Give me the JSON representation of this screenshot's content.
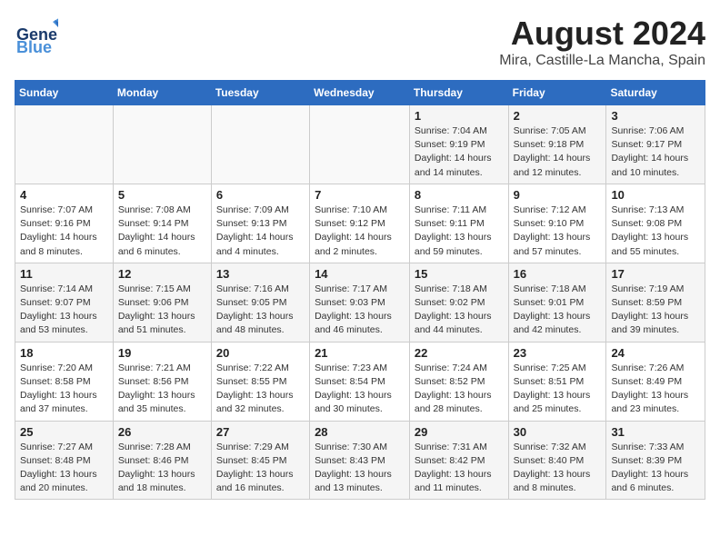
{
  "header": {
    "logo_general": "General",
    "logo_blue": "Blue",
    "month_year": "August 2024",
    "location": "Mira, Castille-La Mancha, Spain"
  },
  "days_of_week": [
    "Sunday",
    "Monday",
    "Tuesday",
    "Wednesday",
    "Thursday",
    "Friday",
    "Saturday"
  ],
  "weeks": [
    [
      {
        "day": "",
        "info": ""
      },
      {
        "day": "",
        "info": ""
      },
      {
        "day": "",
        "info": ""
      },
      {
        "day": "",
        "info": ""
      },
      {
        "day": "1",
        "info": "Sunrise: 7:04 AM\nSunset: 9:19 PM\nDaylight: 14 hours\nand 14 minutes."
      },
      {
        "day": "2",
        "info": "Sunrise: 7:05 AM\nSunset: 9:18 PM\nDaylight: 14 hours\nand 12 minutes."
      },
      {
        "day": "3",
        "info": "Sunrise: 7:06 AM\nSunset: 9:17 PM\nDaylight: 14 hours\nand 10 minutes."
      }
    ],
    [
      {
        "day": "4",
        "info": "Sunrise: 7:07 AM\nSunset: 9:16 PM\nDaylight: 14 hours\nand 8 minutes."
      },
      {
        "day": "5",
        "info": "Sunrise: 7:08 AM\nSunset: 9:14 PM\nDaylight: 14 hours\nand 6 minutes."
      },
      {
        "day": "6",
        "info": "Sunrise: 7:09 AM\nSunset: 9:13 PM\nDaylight: 14 hours\nand 4 minutes."
      },
      {
        "day": "7",
        "info": "Sunrise: 7:10 AM\nSunset: 9:12 PM\nDaylight: 14 hours\nand 2 minutes."
      },
      {
        "day": "8",
        "info": "Sunrise: 7:11 AM\nSunset: 9:11 PM\nDaylight: 13 hours\nand 59 minutes."
      },
      {
        "day": "9",
        "info": "Sunrise: 7:12 AM\nSunset: 9:10 PM\nDaylight: 13 hours\nand 57 minutes."
      },
      {
        "day": "10",
        "info": "Sunrise: 7:13 AM\nSunset: 9:08 PM\nDaylight: 13 hours\nand 55 minutes."
      }
    ],
    [
      {
        "day": "11",
        "info": "Sunrise: 7:14 AM\nSunset: 9:07 PM\nDaylight: 13 hours\nand 53 minutes."
      },
      {
        "day": "12",
        "info": "Sunrise: 7:15 AM\nSunset: 9:06 PM\nDaylight: 13 hours\nand 51 minutes."
      },
      {
        "day": "13",
        "info": "Sunrise: 7:16 AM\nSunset: 9:05 PM\nDaylight: 13 hours\nand 48 minutes."
      },
      {
        "day": "14",
        "info": "Sunrise: 7:17 AM\nSunset: 9:03 PM\nDaylight: 13 hours\nand 46 minutes."
      },
      {
        "day": "15",
        "info": "Sunrise: 7:18 AM\nSunset: 9:02 PM\nDaylight: 13 hours\nand 44 minutes."
      },
      {
        "day": "16",
        "info": "Sunrise: 7:18 AM\nSunset: 9:01 PM\nDaylight: 13 hours\nand 42 minutes."
      },
      {
        "day": "17",
        "info": "Sunrise: 7:19 AM\nSunset: 8:59 PM\nDaylight: 13 hours\nand 39 minutes."
      }
    ],
    [
      {
        "day": "18",
        "info": "Sunrise: 7:20 AM\nSunset: 8:58 PM\nDaylight: 13 hours\nand 37 minutes."
      },
      {
        "day": "19",
        "info": "Sunrise: 7:21 AM\nSunset: 8:56 PM\nDaylight: 13 hours\nand 35 minutes."
      },
      {
        "day": "20",
        "info": "Sunrise: 7:22 AM\nSunset: 8:55 PM\nDaylight: 13 hours\nand 32 minutes."
      },
      {
        "day": "21",
        "info": "Sunrise: 7:23 AM\nSunset: 8:54 PM\nDaylight: 13 hours\nand 30 minutes."
      },
      {
        "day": "22",
        "info": "Sunrise: 7:24 AM\nSunset: 8:52 PM\nDaylight: 13 hours\nand 28 minutes."
      },
      {
        "day": "23",
        "info": "Sunrise: 7:25 AM\nSunset: 8:51 PM\nDaylight: 13 hours\nand 25 minutes."
      },
      {
        "day": "24",
        "info": "Sunrise: 7:26 AM\nSunset: 8:49 PM\nDaylight: 13 hours\nand 23 minutes."
      }
    ],
    [
      {
        "day": "25",
        "info": "Sunrise: 7:27 AM\nSunset: 8:48 PM\nDaylight: 13 hours\nand 20 minutes."
      },
      {
        "day": "26",
        "info": "Sunrise: 7:28 AM\nSunset: 8:46 PM\nDaylight: 13 hours\nand 18 minutes."
      },
      {
        "day": "27",
        "info": "Sunrise: 7:29 AM\nSunset: 8:45 PM\nDaylight: 13 hours\nand 16 minutes."
      },
      {
        "day": "28",
        "info": "Sunrise: 7:30 AM\nSunset: 8:43 PM\nDaylight: 13 hours\nand 13 minutes."
      },
      {
        "day": "29",
        "info": "Sunrise: 7:31 AM\nSunset: 8:42 PM\nDaylight: 13 hours\nand 11 minutes."
      },
      {
        "day": "30",
        "info": "Sunrise: 7:32 AM\nSunset: 8:40 PM\nDaylight: 13 hours\nand 8 minutes."
      },
      {
        "day": "31",
        "info": "Sunrise: 7:33 AM\nSunset: 8:39 PM\nDaylight: 13 hours\nand 6 minutes."
      }
    ]
  ]
}
